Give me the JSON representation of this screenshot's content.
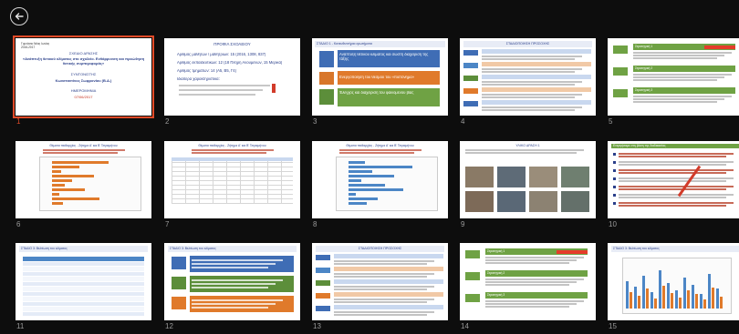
{
  "header": {
    "back_icon": "back-arrow-icon"
  },
  "selected_slide": 1,
  "slides": [
    {
      "number": "1",
      "lines": [
        "Γυμνάσιο Νέας Ιωνίας",
        "2016-2017",
        "ΣΧΕΔΙΟ ΔΡΑΣΗΣ",
        "«Ανάπτυξη θετικού κλίματος στο σχολείο. Ενθάρρυνση και προώθηση θετικής συμπεριφοράς»",
        "ΣΥΝΤΟΝΙΣΤΗΣ",
        "Κωνσταντίνος Σωφρονίου (Β.Δ.)",
        "ΗΜΕΡΟΜΗΝΙΑ",
        "07/06/2017"
      ]
    },
    {
      "number": "2",
      "lines": [
        "ΠΡΟΦΙΛ ΣΧΟΛΕΙΟΥ",
        "Αριθμός μαθητών / μαθητριών: 15 (2016, 1308, 837)",
        "Αριθμός εκπαιδευτικών: 12 (18 Πλήρη Ανουμένων, 15 Μερικά)",
        "Αριθμός τμημάτων: 14 (Α5, Β5, Γ4)",
        "Ιδιαίτερα χαρακτηριστικά:"
      ]
    },
    {
      "number": "3",
      "lines": [
        "ΣΤΑΔΙΟ 1 - Κατευθυντήρια ερωτήματα",
        "Ανάπτυξη θετικού κλίματος και σωστή διαχείριση της τάξης",
        "Ενεργοποίηση του θεσμού του «πιστόνημα»",
        "Έλεγχος και διαχείριση του φαινομένου βίας"
      ]
    },
    {
      "number": "4",
      "lines": [
        "ΣΤΑΔΙΟΠΟΙΗΣΗ ΠΡΟΣΟΧΗΣ"
      ]
    },
    {
      "number": "5",
      "lines": [
        "Στρατηγική 1",
        "Στρατηγική 2",
        "Στρατηγική 3"
      ]
    },
    {
      "number": "6",
      "lines": [
        "Θέματα πειθαρχίας - Ζήτημα Α' και Β' Τετραμήνου"
      ]
    },
    {
      "number": "7",
      "lines": [
        "Θέματα πειθαρχίας - Ζήτημα Α' και Β' Τετραμήνου"
      ]
    },
    {
      "number": "8",
      "lines": [
        "Θέματα πειθαρχίας - Ζήτημα Α' και Β' Τετραμήνου"
      ]
    },
    {
      "number": "9",
      "lines": [
        "ΥΛΙΚΟ ΔΡΑΣΗ 1"
      ]
    },
    {
      "number": "10",
      "lines": [
        "Ενεργήσαμε στη βάση της διαδικασίας"
      ]
    },
    {
      "number": "11",
      "lines": [
        "ΣΤΑΔΙΟ 3: Βελτίωση του κλίματος"
      ]
    },
    {
      "number": "12",
      "lines": [
        "ΣΤΑΔΙΟ 3: Βελτίωση του κλίματος"
      ]
    },
    {
      "number": "13",
      "lines": [
        "ΣΤΑΔΙΟΠΟΙΗΣΗ ΠΡΟΣΟΧΗΣ"
      ]
    },
    {
      "number": "14",
      "lines": [
        "Στρατηγική 1",
        "Στρατηγική 2",
        "Στρατηγική 3"
      ]
    },
    {
      "number": "15",
      "lines": [
        "ΣΤΑΔΙΟ 3: Βελτίωση του κλίματος"
      ]
    }
  ]
}
